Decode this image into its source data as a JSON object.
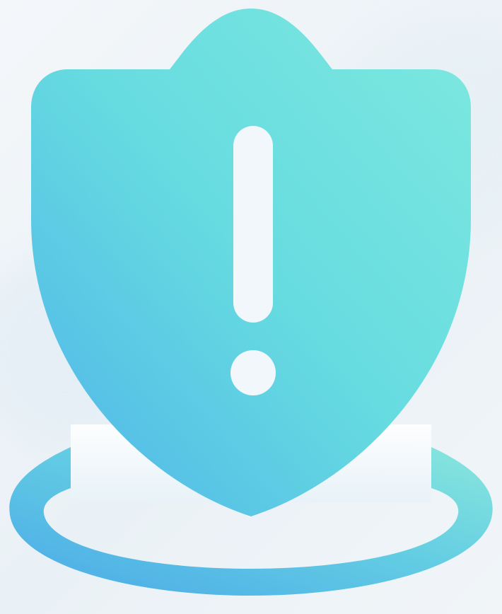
{
  "illustration": {
    "icon": "shield-exclamation-icon",
    "colors": {
      "background": "#eef3f7",
      "shield_light": "#7de9e0",
      "shield_mid": "#62d9df",
      "shield_dark": "#4fb6ea",
      "ring_light": "#86e6dc",
      "ring_dark": "#4eb0e8",
      "mark": "#f4f8fb"
    }
  }
}
